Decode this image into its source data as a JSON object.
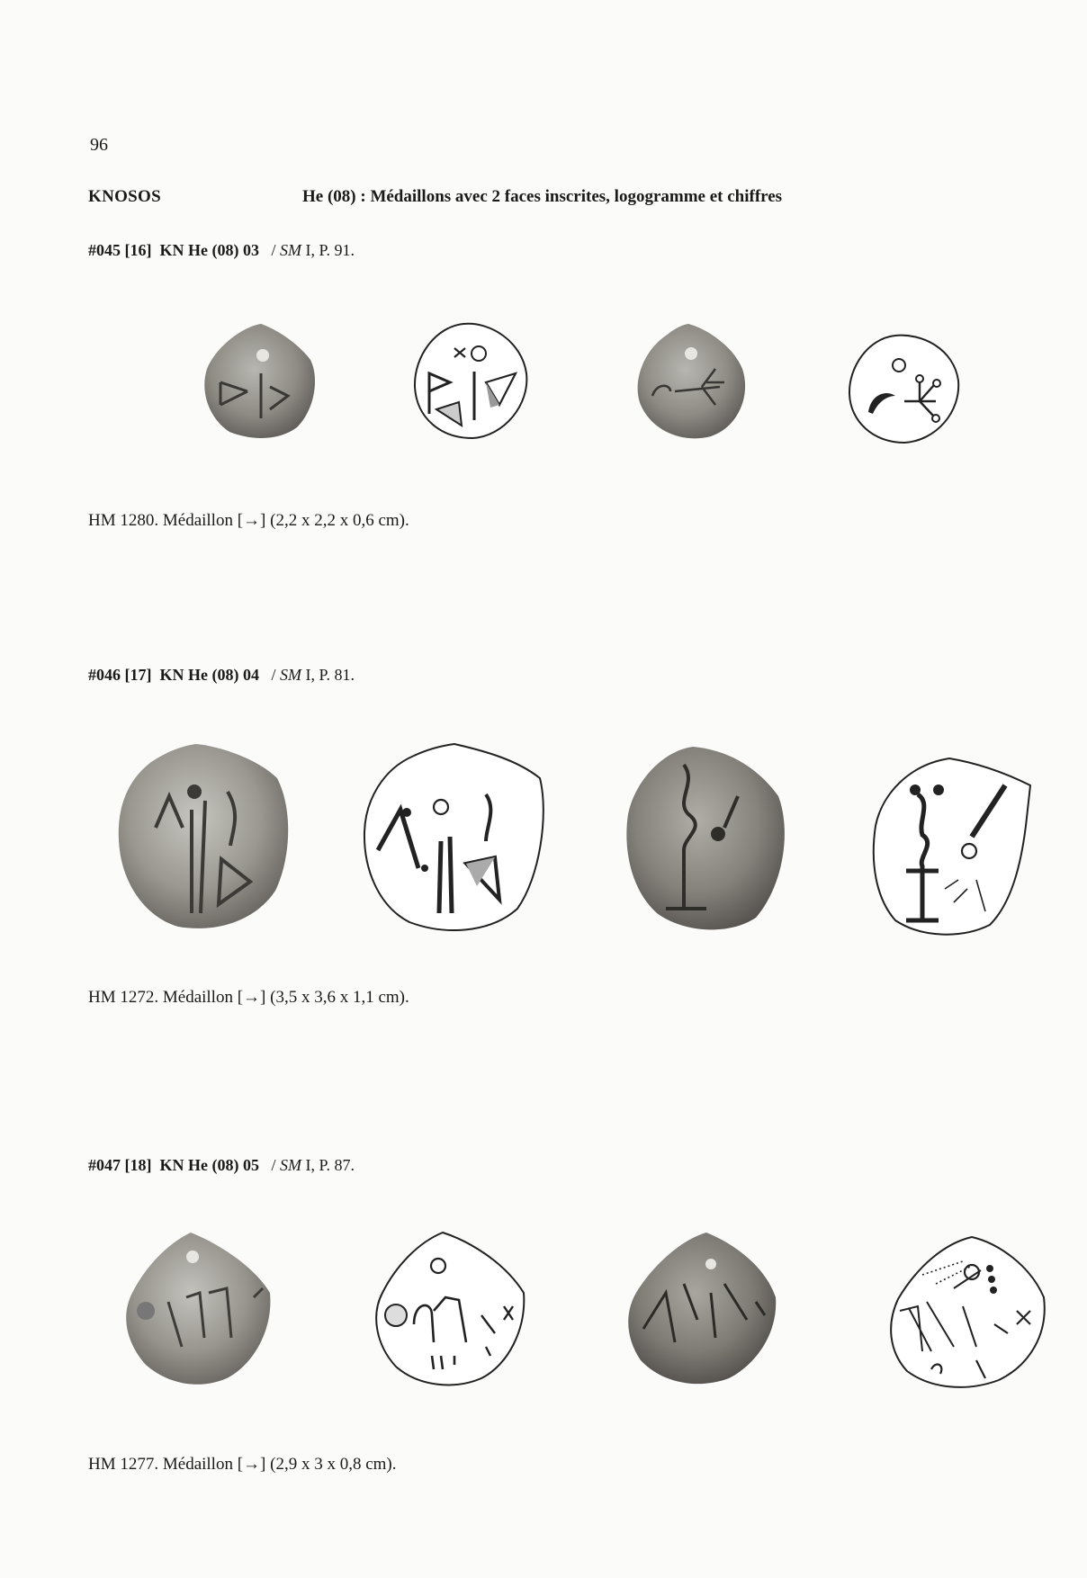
{
  "page": {
    "number": "96",
    "section": "KNOSOS",
    "subtitle": "He (08) : Médaillons avec 2 faces inscrites, logogramme et chiffres"
  },
  "entries": [
    {
      "num": "#045",
      "bracket": "[16]",
      "ref": "KN He (08) 03",
      "sep": "/",
      "sm": "SM",
      "page_ref": "I, P. 91.",
      "caption": "HM 1280. Médaillon [→] (2,2 x 2,2 x 0,6 cm)."
    },
    {
      "num": "#046",
      "bracket": "[17]",
      "ref": "KN He (08) 04",
      "sep": "/",
      "sm": "SM",
      "page_ref": "I, P. 81.",
      "caption": "HM 1272. Médaillon [→] (3,5 x 3,6 x 1,1 cm)."
    },
    {
      "num": "#047",
      "bracket": "[18]",
      "ref": "KN He (08) 05",
      "sep": "/",
      "sm": "SM",
      "page_ref": "I, P. 87.",
      "caption": "HM 1277. Médaillon [→] (2,9 x 3 x 0,8 cm)."
    }
  ]
}
